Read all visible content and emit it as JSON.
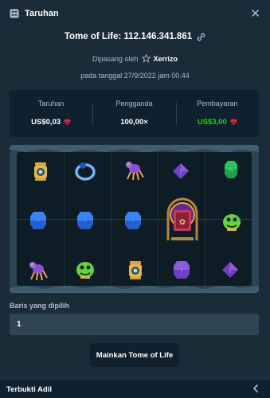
{
  "header": {
    "title": "Taruhan",
    "icon": "bet-slip-icon",
    "close_icon": "close-icon"
  },
  "game": {
    "name": "Tome of Life",
    "bet_id": "112.146.341.861",
    "copy_icon": "copy-icon"
  },
  "placed": {
    "prefix": "Dipasang oleh",
    "user": "Xerrizo",
    "user_icon": "star-icon",
    "date": "pada tanggal 27/9/2022 jam 00.44"
  },
  "stats": {
    "bet_label": "Taruhan",
    "bet_value": "US$0,03",
    "multiplier_label": "Pengganda",
    "multiplier_value": "100,00×",
    "payout_label": "Pembayaran",
    "payout_value": "US$3,00",
    "payout_color": "#00e701",
    "currency_icon": "ruby-gem-icon"
  },
  "board": {
    "rows": [
      [
        "lantern-icon",
        "ring-icon",
        "spider-icon",
        "purple-gem-icon",
        "green-gem-icon"
      ],
      [
        "blue-gem-icon",
        "blue-gem-icon",
        "blue-gem-icon",
        "tome-scatter-icon",
        "slime-icon"
      ],
      [
        "spider-icon",
        "slime-icon",
        "lantern-icon",
        "purple-gem-icon",
        "purple-gem-icon"
      ]
    ]
  },
  "rows": {
    "label": "Baris yang dipilih",
    "value": "1"
  },
  "play": {
    "label": "Mainkan Tome of Life"
  },
  "footer": {
    "label": "Terbukti Adil",
    "chevron_icon": "chevron-left-icon"
  },
  "colors": {
    "background": "#1a2c38",
    "panel": "#0f212e",
    "input": "#2f4553",
    "muted_text": "#b1bad3"
  }
}
